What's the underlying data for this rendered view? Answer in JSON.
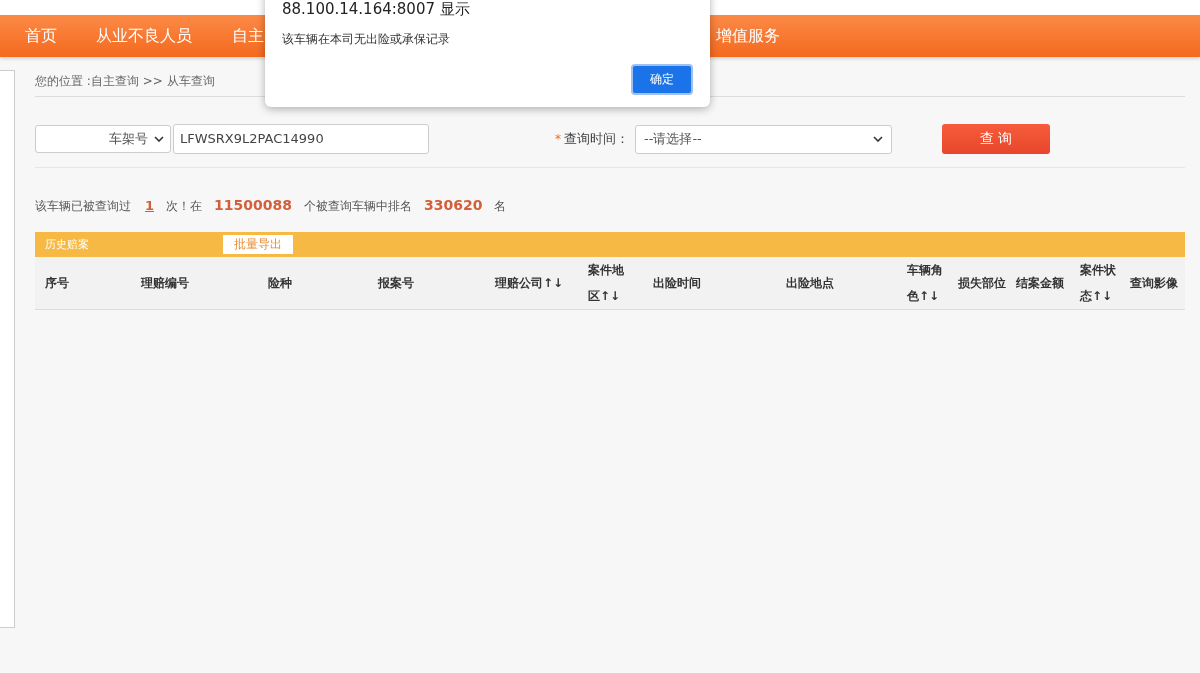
{
  "navigation": {
    "items": [
      {
        "label": "首页"
      },
      {
        "label": "从业不良人员"
      },
      {
        "label": "自主"
      },
      {
        "label": "增值服务"
      }
    ]
  },
  "breadcrumb": "您的位置 :自主查询 >> 从车查询",
  "search": {
    "id_type": "车架号",
    "vin": "LFWSRX9L2PAC14990",
    "required_mark": "*",
    "time_label": "查询时间：",
    "time_select": "--请选择--",
    "submit": "查 询"
  },
  "stats": {
    "prefix": "该车辆已被查询过",
    "count": "1",
    "middle": "次！在",
    "total": "11500088",
    "middle2": "个被查询车辆中排名",
    "rank": "330620",
    "suffix": "名"
  },
  "claims": {
    "title": "历史赔案",
    "export": "批量导出",
    "columns": [
      {
        "label": "序号"
      },
      {
        "label": "理赔编号"
      },
      {
        "label": "险种"
      },
      {
        "label": "报案号"
      },
      {
        "label": "理赔公司↑↓"
      },
      {
        "label": "案件地区↑↓"
      },
      {
        "label": "出险时间"
      },
      {
        "label": "出险地点"
      },
      {
        "label": "车辆角色↑↓"
      },
      {
        "label": "损失部位"
      },
      {
        "label": "结案金额"
      },
      {
        "label": "案件状态↑↓"
      },
      {
        "label": "查询影像"
      }
    ]
  },
  "dialog": {
    "title": "88.100.14.164:8007 显示",
    "message": "该车辆在本司无出险或承保记录",
    "button": "确定"
  }
}
